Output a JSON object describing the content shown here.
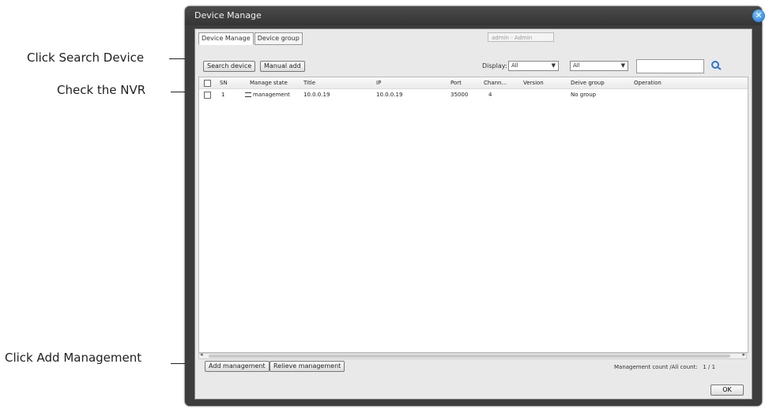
{
  "callouts": {
    "search": "Click Search Device",
    "check": "Check the NVR",
    "add": "Click Add Management"
  },
  "window": {
    "title": "Device Manage",
    "close_icon": "close-icon"
  },
  "tabs": [
    {
      "label": "Device Manage",
      "active": true
    },
    {
      "label": "Device group",
      "active": false
    }
  ],
  "user_select": {
    "value": "admin - Admin"
  },
  "toolbar": {
    "search_label": "Search device",
    "manual_add_label": "Manual add",
    "display_label": "Display:",
    "display_filter_1": "All",
    "display_filter_2": "All",
    "search_placeholder": "",
    "search_icon": "search-icon"
  },
  "table": {
    "headers": [
      "SN",
      "Manage state",
      "Title",
      "IP",
      "Port",
      "Chann...",
      "Version",
      "Deive group",
      "Operation"
    ],
    "rows": [
      {
        "sn": "1",
        "state": "management",
        "title": "10.0.0.19",
        "ip": "10.0.0.19",
        "port": "35000",
        "channels": "4",
        "version": "",
        "group": "No group",
        "operation": ""
      }
    ]
  },
  "footer": {
    "add_label": "Add management",
    "relieve_label": "Relieve management",
    "count_label": "Management count /All count:",
    "count_value": "1 / 1",
    "ok_label": "OK"
  }
}
